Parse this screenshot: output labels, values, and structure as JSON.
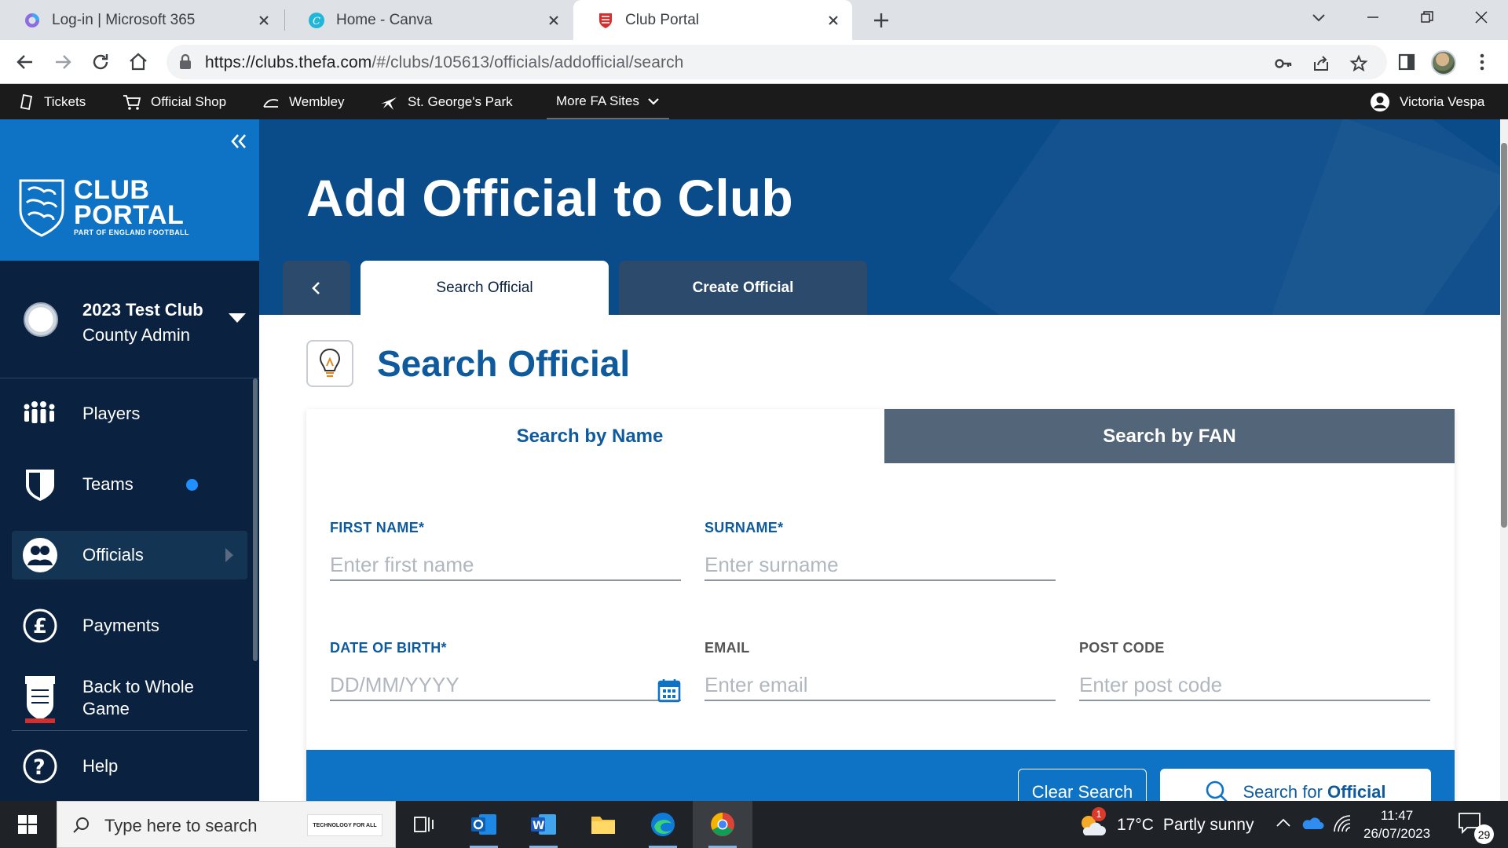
{
  "browser": {
    "tabs": [
      {
        "title": "Log-in | Microsoft 365",
        "active": false
      },
      {
        "title": "Home - Canva",
        "active": false
      },
      {
        "title": "Club Portal",
        "active": true
      }
    ],
    "url_host": "https://clubs.thefa.com",
    "url_path": "/#/clubs/105613/officials/addofficial/search"
  },
  "fabar": {
    "tickets": "Tickets",
    "shop": "Official Shop",
    "wembley": "Wembley",
    "stgeorges": "St. George's Park",
    "more": "More FA Sites",
    "user": "Victoria Vespa"
  },
  "sidebar": {
    "logo_line1": "CLUB",
    "logo_line2": "PORTAL",
    "logo_sub": "PART OF ENGLAND FOOTBALL",
    "club_name": "2023 Test Club",
    "club_role": "County Admin",
    "items": [
      {
        "label": "Players"
      },
      {
        "label": "Teams"
      },
      {
        "label": "Officials"
      },
      {
        "label": "Payments"
      },
      {
        "label": "Back to Whole Game"
      },
      {
        "label": "Help"
      }
    ]
  },
  "main": {
    "page_title": "Add Official to Club",
    "tabs": [
      {
        "label": "Search Official"
      },
      {
        "label": "Create Official"
      }
    ],
    "section_title": "Search Official",
    "subtabs": [
      {
        "label": "Search by Name"
      },
      {
        "label": "Search by FAN"
      }
    ],
    "fields": {
      "first_name": {
        "label": "FIRST NAME*",
        "placeholder": "Enter first name",
        "value": ""
      },
      "surname": {
        "label": "SURNAME*",
        "placeholder": "Enter surname",
        "value": ""
      },
      "dob": {
        "label": "DATE OF BIRTH*",
        "placeholder": "DD/MM/YYYY",
        "value": ""
      },
      "email": {
        "label": "EMAIL",
        "placeholder": "Enter email",
        "value": ""
      },
      "postcode": {
        "label": "POST CODE",
        "placeholder": "Enter post code",
        "value": ""
      }
    },
    "clear_label": "Clear Search",
    "search_label_prefix": "Search for ",
    "search_label_strong": "Official"
  },
  "taskbar": {
    "search_placeholder": "Type here to search",
    "promo": "TECHNOLOGY FOR ALL",
    "weather_temp": "17°C",
    "weather_text": "Partly sunny",
    "time": "11:47",
    "date": "26/07/2023",
    "notifications": "29",
    "weather_badge": "1"
  },
  "colors": {
    "hero": "#0a4b8a",
    "sidebar": "#0a2240",
    "brand_blue": "#0e72c5",
    "label_blue": "#0e5a9c"
  }
}
